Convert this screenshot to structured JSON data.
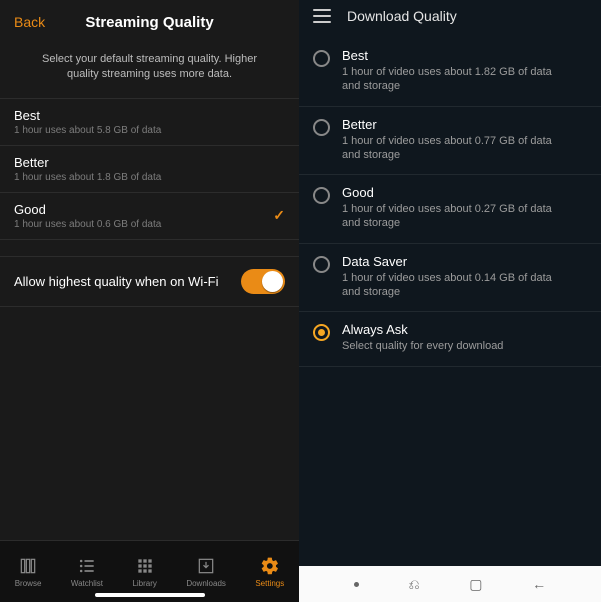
{
  "left": {
    "back": "Back",
    "title": "Streaming Quality",
    "desc": "Select your default streaming quality. Higher quality streaming uses more data.",
    "items": [
      {
        "label": "Best",
        "sub": "1 hour uses about 5.8 GB of data",
        "selected": false
      },
      {
        "label": "Better",
        "sub": "1 hour uses about 1.8 GB of data",
        "selected": false
      },
      {
        "label": "Good",
        "sub": "1 hour uses about 0.6 GB of data",
        "selected": true
      }
    ],
    "toggle": {
      "label": "Allow highest quality when on Wi-Fi",
      "on": true
    },
    "tabs": [
      {
        "label": "Browse"
      },
      {
        "label": "Watchlist"
      },
      {
        "label": "Library"
      },
      {
        "label": "Downloads"
      },
      {
        "label": "Settings"
      }
    ]
  },
  "right": {
    "title": "Download Quality",
    "items": [
      {
        "label": "Best",
        "sub": "1 hour of video uses about 1.82 GB of data and storage",
        "selected": false
      },
      {
        "label": "Better",
        "sub": "1 hour of video uses about 0.77 GB of data and storage",
        "selected": false
      },
      {
        "label": "Good",
        "sub": "1 hour of video uses about 0.27 GB of data and storage",
        "selected": false
      },
      {
        "label": "Data Saver",
        "sub": "1 hour of video uses about 0.14 GB of data and storage",
        "selected": false
      },
      {
        "label": "Always Ask",
        "sub": "Select quality for every download",
        "selected": true
      }
    ]
  }
}
